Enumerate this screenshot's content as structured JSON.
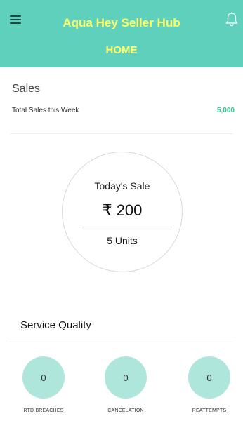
{
  "header": {
    "app_title": "Aqua Hey Seller Hub",
    "page_title": "HOME"
  },
  "sales": {
    "title": "Sales",
    "weekly_label": "Total Sales this Week",
    "weekly_value": "5,000"
  },
  "today": {
    "label": "Today's Sale",
    "amount": "₹ 200",
    "units": "5 Units"
  },
  "service_quality": {
    "title": "Service Quality",
    "metrics": [
      {
        "value": "0",
        "label": "RTD BREACHES"
      },
      {
        "value": "0",
        "label": "CANCELATION"
      },
      {
        "value": "0",
        "label": "REATTEMPTS"
      }
    ]
  },
  "colors": {
    "header_bg": "#5fd0bc",
    "header_text": "#ffff66",
    "metric_circle": "#aee6dc",
    "weekly_value": "#2dc98f"
  }
}
